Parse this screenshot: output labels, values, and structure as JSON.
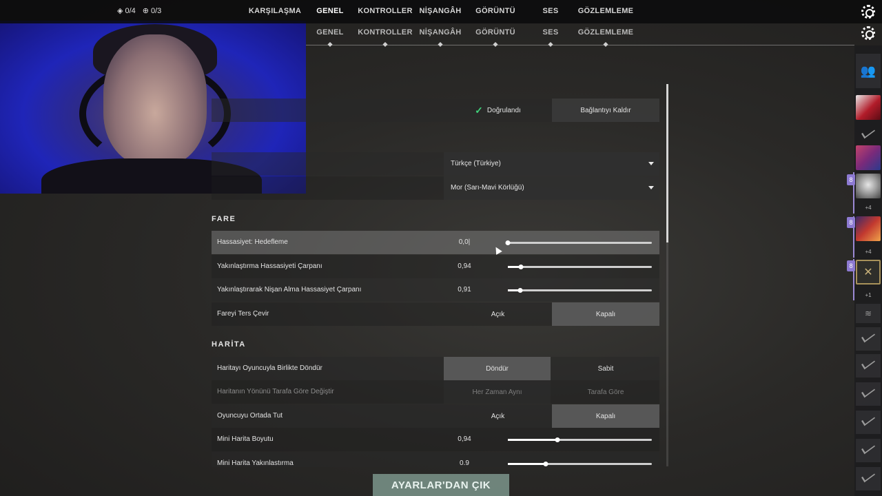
{
  "counters": {
    "first": "0/4",
    "second": "0/3"
  },
  "nav_top": [
    "KARŞILAŞMA",
    "GENEL",
    "KONTROLLER",
    "NİŞANGÂH",
    "GÖRÜNTÜ",
    "SES",
    "GÖZLEMLEME"
  ],
  "nav_sub": [
    "GENEL",
    "KONTROLLER",
    "NİŞANGÂH",
    "GÖRÜNTÜ",
    "SES",
    "GÖZLEMLEME"
  ],
  "account": {
    "verified_label": "Doğrulandı",
    "disconnect_label": "Bağlantıyı Kaldır"
  },
  "language": {
    "value": "Türkçe (Türkiye)"
  },
  "colorblind": {
    "value": "Mor (Sarı-Mavi Körlüğü)"
  },
  "fare": {
    "title": "FARE",
    "sensitivity": {
      "label": "Hassasiyet: Hedefleme",
      "value": "0,0|",
      "fraction": 0.0
    },
    "zoom_mult": {
      "label": "Yakınlaştırma Hassasiyeti Çarpanı",
      "value": "0,94",
      "fraction": 0.09
    },
    "ads_mult": {
      "label": "Yakınlaştırarak Nişan Alma Hassasiyet Çarpanı",
      "value": "0,91",
      "fraction": 0.085
    },
    "invert": {
      "label": "Fareyi Ters Çevir",
      "on": "Açık",
      "off": "Kapalı"
    }
  },
  "harita": {
    "title": "HARİTA",
    "rotate": {
      "label": "Haritayı Oyuncuyla Birlikte Döndür",
      "a": "Döndür",
      "b": "Sabit"
    },
    "orientation": {
      "label": "Haritanın Yönünü Tarafa Göre Değiştir",
      "a": "Her Zaman Aynı",
      "b": "Tarafa Göre"
    },
    "center": {
      "label": "Oyuncuyu Ortada Tut",
      "on": "Açık",
      "off": "Kapalı"
    },
    "size": {
      "label": "Mini Harita Boyutu",
      "value": "0,94",
      "fraction": 0.345
    },
    "zoom": {
      "label": "Mini Harita Yakınlastırma",
      "value": "0.9",
      "fraction": 0.265
    }
  },
  "exit_button": "AYARLAR'DAN ÇIK",
  "social": {
    "counts": [
      "+4",
      "+4",
      "+1"
    ],
    "badge": "8"
  },
  "colors": {
    "accent_exit": "#a9d2c3",
    "party": "#8d7ad2"
  },
  "icons": [
    "rank-icon",
    "plus-circle-icon",
    "settings-gear-icon",
    "checkmark-icon",
    "chevron-down-icon",
    "friends-icon"
  ]
}
